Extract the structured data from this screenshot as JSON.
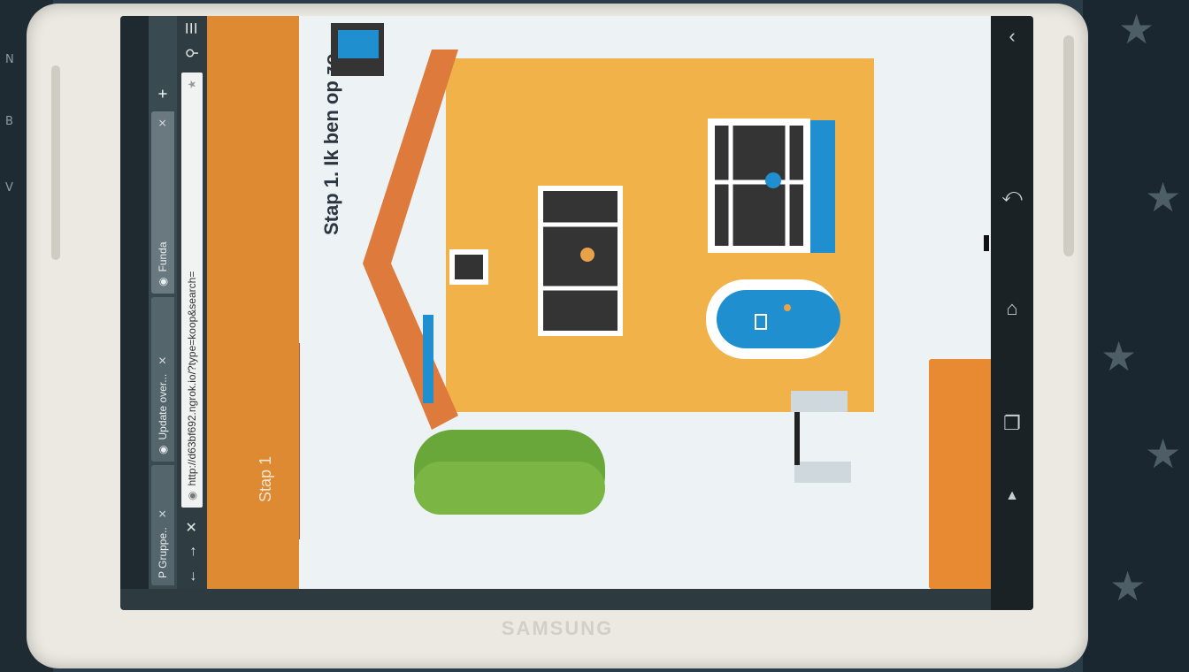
{
  "browser": {
    "tabs": [
      {
        "label": "P Gruppe..",
        "close": "✕"
      },
      {
        "label": "Update over...",
        "close": "✕"
      },
      {
        "label": "Funda",
        "close": "✕"
      }
    ],
    "new_tab": "+",
    "url": "http://d63bf692.ngrok.io/?type=koop&search=",
    "back": "←",
    "forward": "→",
    "stop": "✕",
    "menu": "☰"
  },
  "page": {
    "step_label": "Stap 1",
    "heading": "Stap 1. Ik ben op zo"
  },
  "device": {
    "brand": "SAMSUNG"
  },
  "colors": {
    "header_orange": "#de8a33",
    "house_yellow": "#f1b24a",
    "roof_orange": "#de7a3c",
    "door_blue": "#1f8fd0",
    "tree_green": "#6aa73b"
  },
  "icons": [
    "back-icon",
    "forward-icon",
    "stop-icon",
    "globe-icon",
    "menu-icon",
    "bookmark-icon",
    "search-icon",
    "system-back-icon",
    "system-home-icon",
    "system-recents-icon"
  ]
}
